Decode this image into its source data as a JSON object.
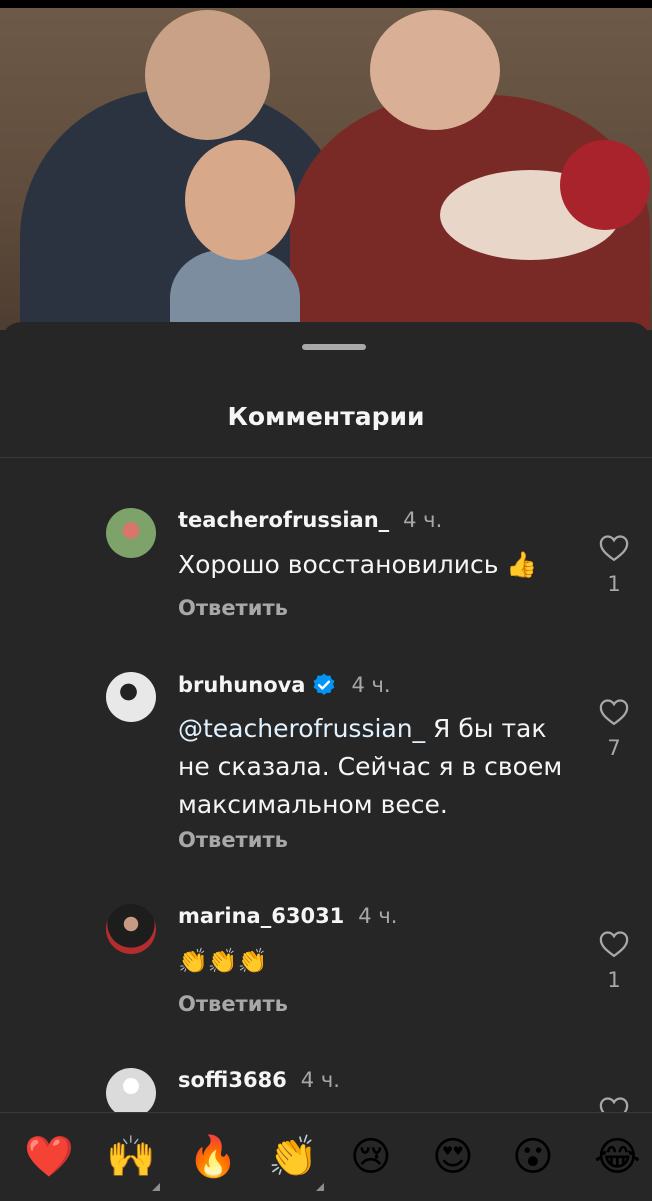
{
  "sheet": {
    "title": "Комментарии"
  },
  "comments": [
    {
      "user": "teacherofrussian_",
      "time": "4 ч.",
      "text": "Хорошо восстановились 👍",
      "reply": "Ответить",
      "likes": "1",
      "verified": false
    },
    {
      "user": "bruhunova",
      "time": "4 ч.",
      "mention": "@teacherofrussian_",
      "text": "Я бы так не сказала. Сейчас я в своем максимальном весе.",
      "reply": "Ответить",
      "likes": "7",
      "verified": true
    },
    {
      "user": "marina_63031",
      "time": "4 ч.",
      "text": "👏👏👏",
      "reply": "Ответить",
      "likes": "1",
      "verified": false
    },
    {
      "user": "soffi3686",
      "time": "4 ч."
    }
  ],
  "emojis": [
    "❤️",
    "🙌",
    "🔥",
    "👏",
    "😢",
    "😍",
    "😮",
    "😂"
  ],
  "colors": {
    "background": "#262626",
    "text": "#f5f5f5",
    "secondary": "#a8a8a8",
    "verified": "#0095f6"
  }
}
